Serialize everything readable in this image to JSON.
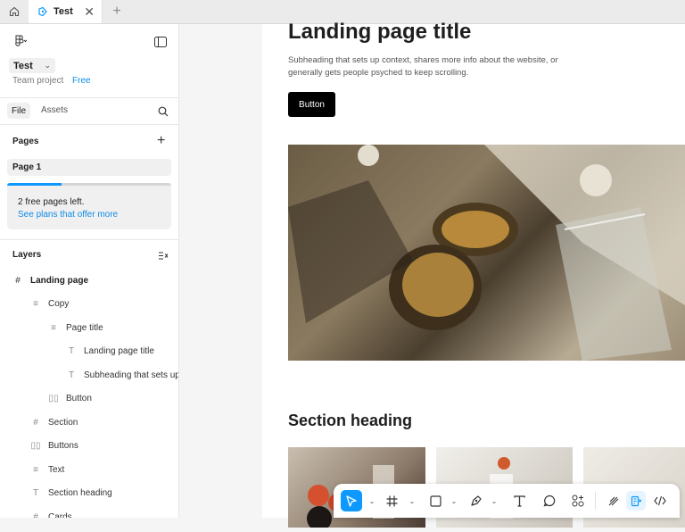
{
  "tabbar": {
    "home_icon": "home-icon",
    "tab_title": "Test",
    "new_tab_label": "+"
  },
  "sidebar": {
    "file_name": "Test",
    "team_label": "Team project",
    "plan_label": "Free",
    "tabs": [
      "File",
      "Assets"
    ],
    "pages_heading": "Pages",
    "pages": [
      "Page 1"
    ],
    "pages_used_fraction": 0.33,
    "free_pages_text": "2 free pages left.",
    "plans_link": "See plans that offer more",
    "layers_heading": "Layers",
    "layers": [
      {
        "name": "Landing page",
        "icon": "frame-icon"
      },
      {
        "name": "Copy",
        "icon": "auto-layout-vertical-icon"
      },
      {
        "name": "Page title",
        "icon": "auto-layout-vertical-icon"
      },
      {
        "name": "Landing page title",
        "icon": "text-icon"
      },
      {
        "name": "Subheading that sets up",
        "icon": "text-icon"
      },
      {
        "name": "Button",
        "icon": "auto-layout-horizontal-icon"
      },
      {
        "name": "Section",
        "icon": "frame-icon"
      },
      {
        "name": "Buttons",
        "icon": "auto-layout-horizontal-icon"
      },
      {
        "name": "Text",
        "icon": "auto-layout-vertical-icon"
      },
      {
        "name": "Section heading",
        "icon": "text-icon"
      },
      {
        "name": "Cards",
        "icon": "frame-icon"
      }
    ]
  },
  "canvas": {
    "title": "Landing page title",
    "subheading": "Subheading that sets up context, shares more info about the website, or generally gets people psyched to keep scrolling.",
    "button_label": "Button",
    "section_heading": "Section heading"
  },
  "toolbar": {
    "tools": [
      "move-tool",
      "frame-tool",
      "shape-tool",
      "pen-tool",
      "text-tool",
      "comment-tool",
      "actions-tool"
    ],
    "active_tool": "move-tool"
  },
  "colors": {
    "accent": "#0d99ff",
    "annotation_arrow": "#e52222"
  }
}
